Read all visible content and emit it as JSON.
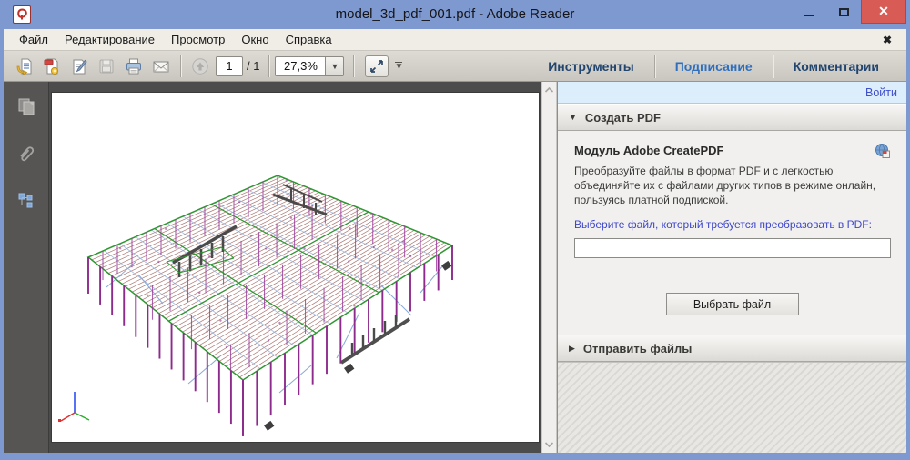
{
  "window": {
    "title": "model_3d_pdf_001.pdf - Adobe Reader",
    "controls": {
      "close_glyph": "✕"
    }
  },
  "menu": {
    "items": [
      "Файл",
      "Редактирование",
      "Просмотр",
      "Окно",
      "Справка"
    ],
    "close_doc_glyph": "✖"
  },
  "toolbar": {
    "icons": [
      "open-file-icon",
      "create-pdf-icon",
      "sign-document-icon",
      "save-icon",
      "print-icon",
      "email-icon"
    ],
    "page_current": "1",
    "page_total": "/ 1",
    "zoom_value": "27,3%",
    "zoom_dropdown_glyph": "▼",
    "more_chevron_glyph": "▼",
    "nav_buttons": [
      {
        "label": "Инструменты",
        "color": "#21456f"
      },
      {
        "label": "Подписание",
        "color": "#2e6fc0"
      },
      {
        "label": "Комментарии",
        "color": "#21456f"
      }
    ]
  },
  "sidebar": {
    "icons": [
      "page-thumbnails-icon",
      "attachments-icon",
      "model-tree-icon"
    ]
  },
  "document": {
    "content": "3d-wireframe-structural-steel-model",
    "colors": {
      "columns": "#8d2b8d",
      "roof_joists": "#97564f",
      "edge_beams": "#2f9632",
      "bracing": "#9db8de",
      "heavy_members": "#4a4a4a",
      "axis_x": "#e23030",
      "axis_y": "#2fae2f",
      "axis_z": "#2b50ef"
    }
  },
  "right_panel": {
    "sign_in_label": "Войти",
    "create_pdf": {
      "collapse_glyph": "▼",
      "header": "Создать PDF",
      "module_title": "Модуль Adobe CreatePDF",
      "description": "Преобразуйте файлы в формат PDF и с легкостью объединяйте их с файлами других типов в режиме онлайн, пользуясь платной подпиской.",
      "file_label": "Выберите файл, который требуется преобразовать в PDF:",
      "file_input_value": "",
      "button_label": "Выбрать файл"
    },
    "send_files": {
      "expand_glyph": "▶",
      "header": "Отправить файлы"
    }
  }
}
